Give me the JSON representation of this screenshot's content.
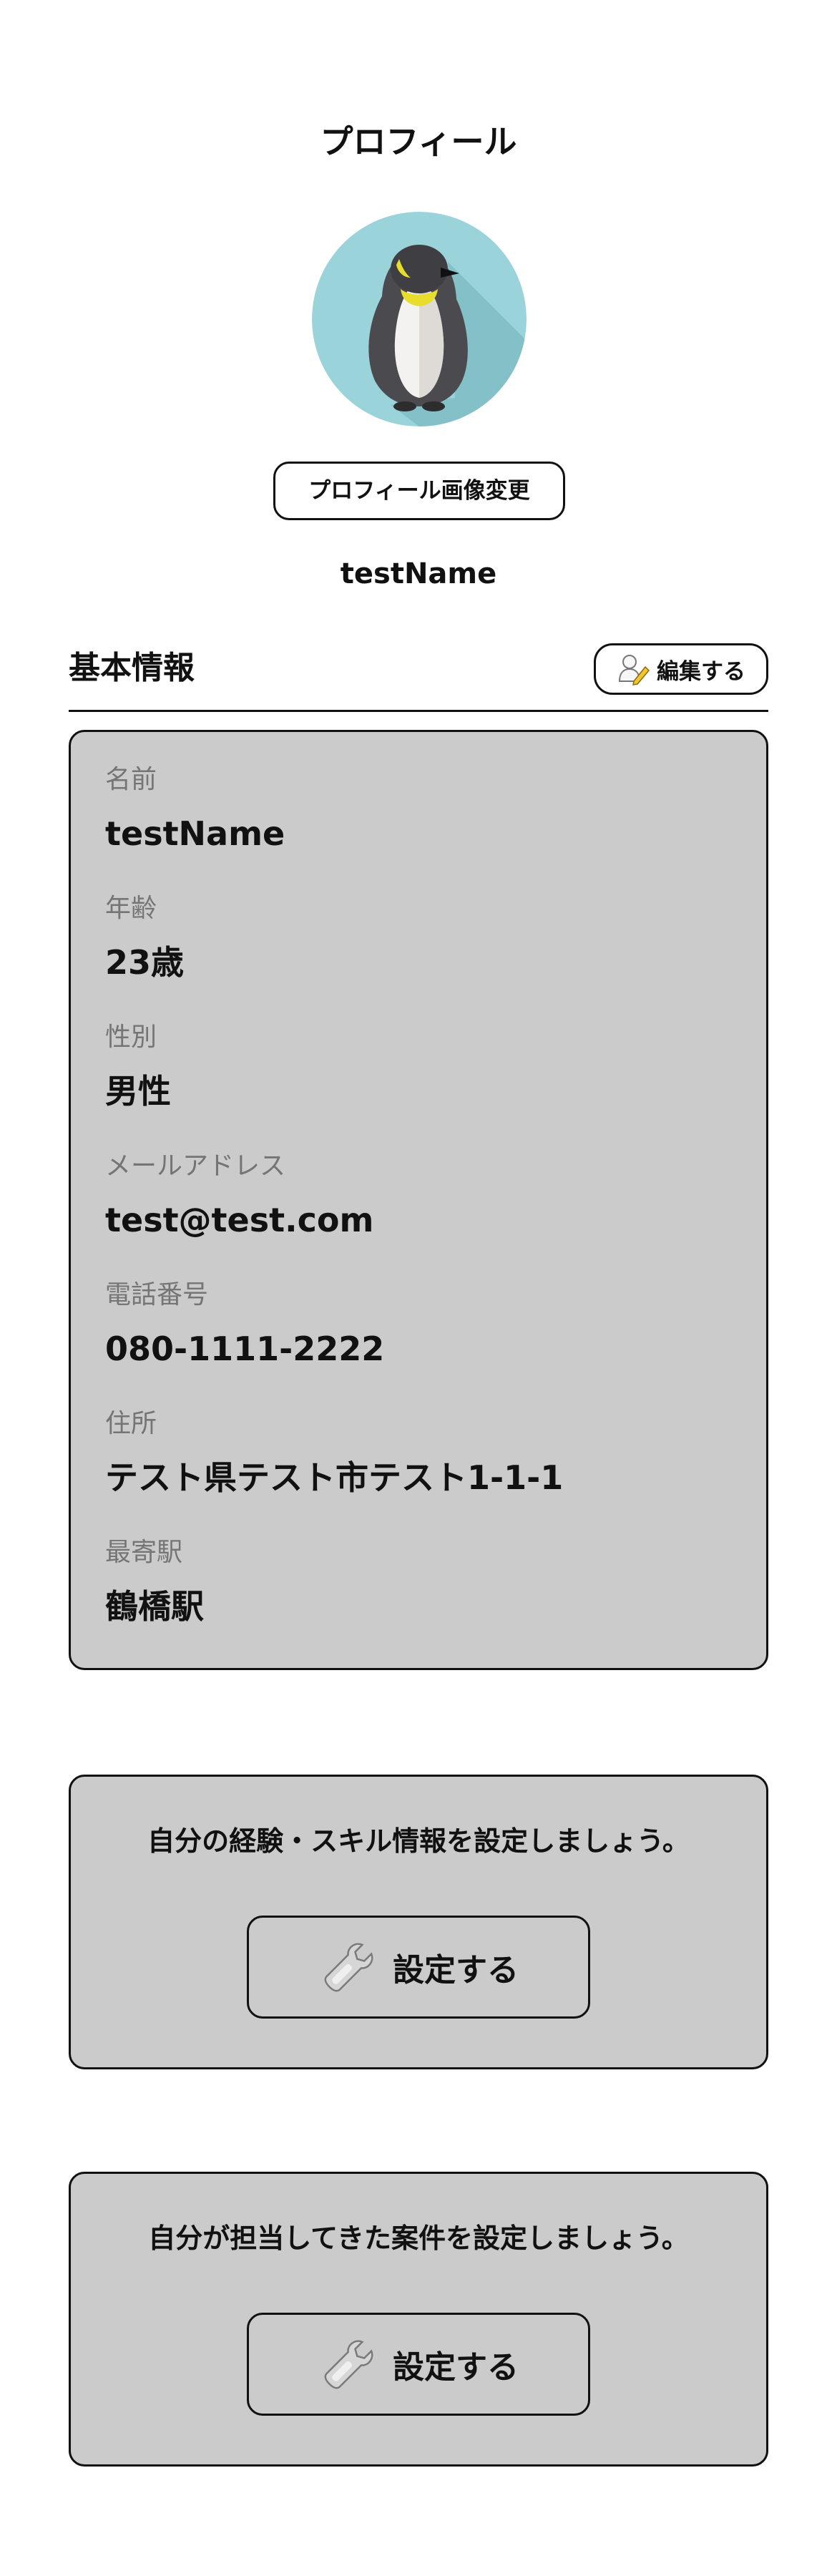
{
  "header": {
    "title": "プロフィール"
  },
  "profile": {
    "avatar_icon": "penguin-avatar-icon",
    "change_photo_label": "プロフィール画像変更",
    "username": "testName"
  },
  "basic_info": {
    "section_title": "基本情報",
    "edit_label": "編集する",
    "edit_icon": "edit-user-icon",
    "fields": [
      {
        "label": "名前",
        "value": "testName"
      },
      {
        "label": "年齢",
        "value": "23歳"
      },
      {
        "label": "性別",
        "value": "男性"
      },
      {
        "label": "メールアドレス",
        "value": "test@test.com"
      },
      {
        "label": "電話番号",
        "value": "080-1111-2222"
      },
      {
        "label": "住所",
        "value": "テスト県テスト市テスト1-1-1"
      },
      {
        "label": "最寄駅",
        "value": "鶴橋駅"
      }
    ]
  },
  "skills": {
    "prompt": "自分の経験・スキル情報を設定しましょう。",
    "button_label": "設定する",
    "button_icon": "wrench-icon"
  },
  "projects": {
    "prompt": "自分が担当してきた案件を設定しましょう。",
    "button_label": "設定する",
    "button_icon": "wrench-icon"
  },
  "colors": {
    "card_background": "#cbcbcb",
    "label_gray": "#757575",
    "avatar_background": "#9ad3da"
  }
}
